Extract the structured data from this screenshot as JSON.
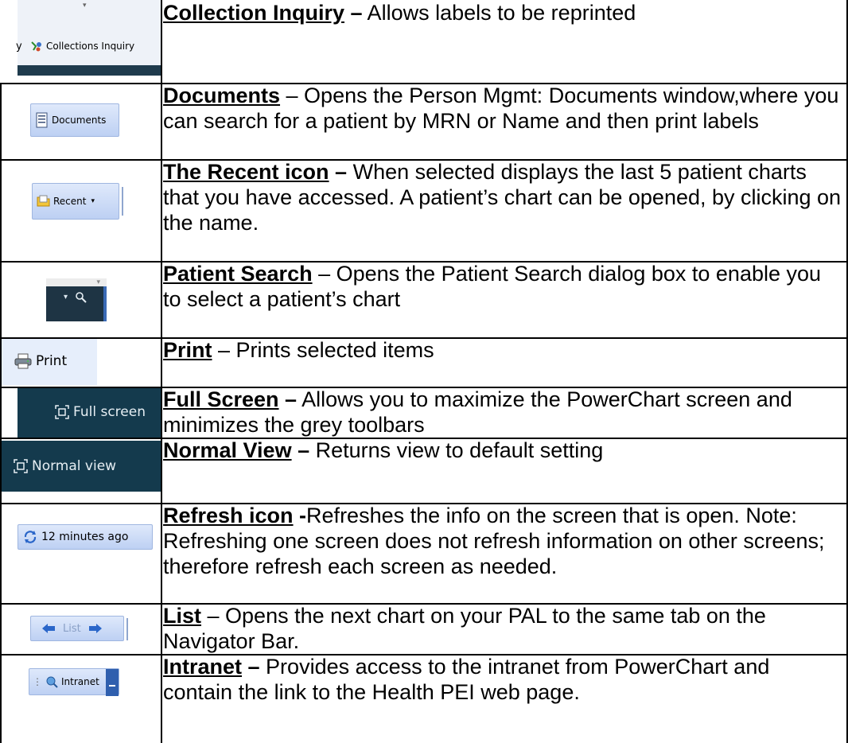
{
  "rows": [
    {
      "term": "Collection Inquiry",
      "sep": " –",
      "text": " Allows labels to be reprinted",
      "icon_label": "Collections Inquiry",
      "icon_prefix": "y",
      "icon": "collections-inquiry-icon"
    },
    {
      "term": "Documents",
      "sep": "",
      "text": " – Opens the Person Mgmt: Documents window,where you can search for a patient by MRN or Name and then print labels",
      "icon_label": "Documents",
      "icon": "document-icon"
    },
    {
      "term": "The Recent icon",
      "sep": " –",
      "text": " When selected displays the last 5 patient charts that you have accessed. A patient’s chart can be opened, by clicking on the name.",
      "icon_label": "Recent",
      "icon": "folder-icon"
    },
    {
      "term": "Patient Search",
      "sep": "",
      "text": " – Opens the Patient Search dialog box to enable you to select a patient’s chart",
      "icon": "magnifier-icon"
    },
    {
      "term": "Print",
      "sep": "",
      "text": " – Prints selected items",
      "icon_label": "Print",
      "icon": "printer-icon"
    },
    {
      "term": "Full Screen",
      "sep": " –",
      "text": " Allows you to maximize the PowerChart screen and  minimizes the grey toolbars",
      "icon_label": "Full screen",
      "icon": "full-screen-icon"
    },
    {
      "term": "Normal View",
      "sep": " –",
      "text": " Returns view to default setting",
      "icon_label": "Normal view",
      "icon": "normal-view-icon"
    },
    {
      "term": "Refresh icon",
      "sep": " -",
      "text": "Refreshes the info on the screen that is open. Note: Refreshing one screen does not refresh information on other screens; therefore refresh each screen as needed.",
      "icon_label": "12 minutes ago",
      "icon": "refresh-icon"
    },
    {
      "term": "List",
      "sep": "",
      "text": " – Opens the next chart on your PAL to the same tab on the Navigator Bar.",
      "icon_label": "List",
      "icon": "arrow-icon"
    },
    {
      "term": "Intranet",
      "sep": " –",
      "text": " Provides access to the intranet from PowerChart and contain the link to the Health PEI web page.",
      "icon_label": "Intranet",
      "icon": "globe-search-icon"
    }
  ],
  "colors": {
    "dark_toolbar": "#143a4d",
    "button_blue": "#bdd0f3",
    "grid": "#000000"
  }
}
